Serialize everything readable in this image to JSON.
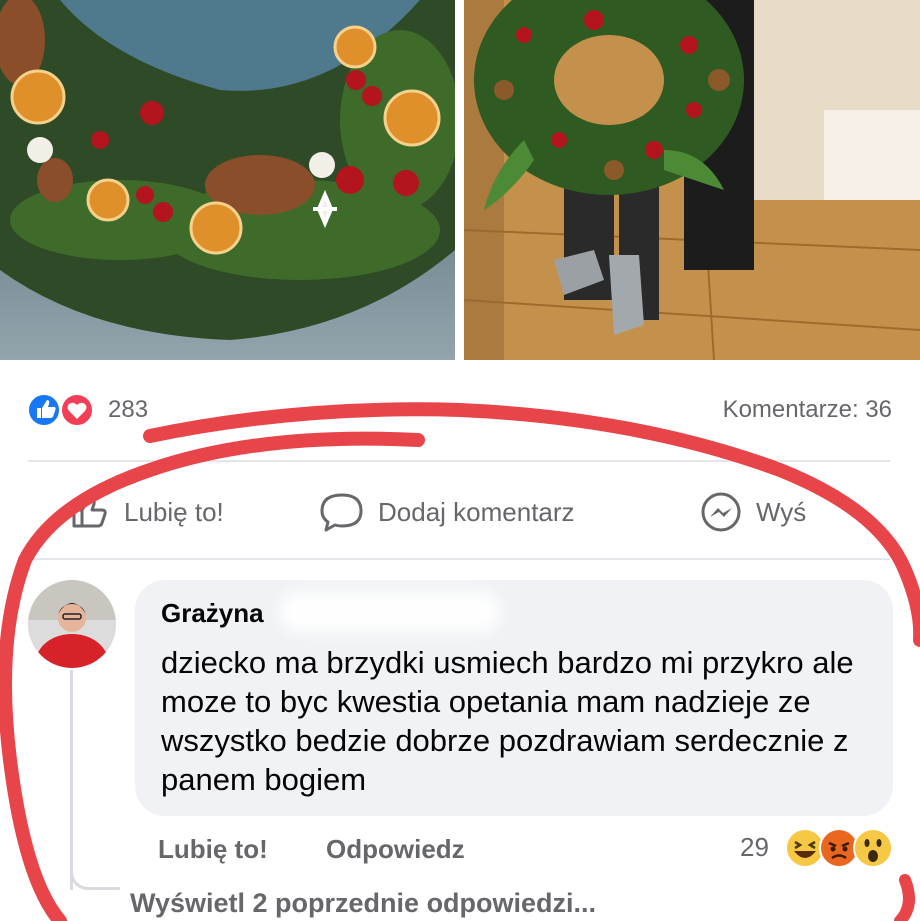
{
  "reactions": {
    "count": "283",
    "icons": [
      "like-icon",
      "love-icon"
    ],
    "colors": {
      "like": "#1877f2",
      "love": "#f33e58"
    }
  },
  "comments_summary": "Komentarze: 36",
  "actions": {
    "like": "Lubię to!",
    "comment": "Dodaj komentarz",
    "send": "Wyś"
  },
  "comment": {
    "author": "Grażyna",
    "text": "dziecko ma brzydki usmiech bardzo mi przykro ale moze to byc kwestia opetania mam nadzieje ze wszystko bedzie dobrze pozdrawiam serdecznie z panem bogiem",
    "like_label": "Lubię to!",
    "reply_label": "Odpowiedz",
    "reaction_count": "29",
    "reaction_icons": [
      "laugh-emoji-icon",
      "angry-emoji-icon",
      "wow-emoji-icon"
    ]
  },
  "view_replies": "Wyświetl 2 poprzednie odpowiedzi...",
  "highlight_color": "#e8454a"
}
